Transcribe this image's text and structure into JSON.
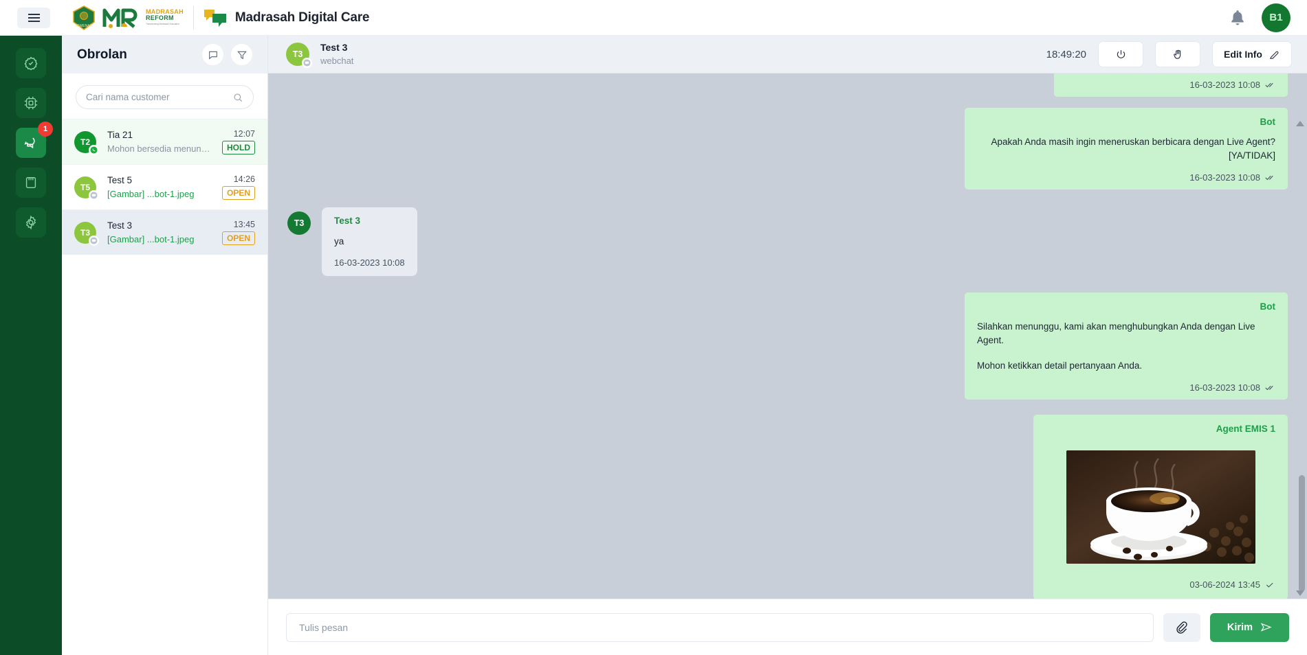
{
  "topbar": {
    "menu_icon": "hamburger-icon",
    "app_title": "Madrasah Digital Care",
    "logo_primary_line1": "MADRASAH",
    "logo_primary_line2": "REFORM",
    "logo_primary_line3": "Transforming Madrasah Education",
    "logo_mark": "MR",
    "bell_icon": "bell-icon",
    "avatar_initials": "B1"
  },
  "rail": {
    "items": [
      {
        "icon": "badge-check-icon",
        "active": false,
        "badge": ""
      },
      {
        "icon": "chip-icon",
        "active": false,
        "badge": ""
      },
      {
        "icon": "chat-bubbles-icon",
        "active": true,
        "badge": "1"
      },
      {
        "icon": "memory-card-icon",
        "active": false,
        "badge": ""
      },
      {
        "icon": "gear-icon",
        "active": false,
        "badge": ""
      }
    ]
  },
  "chat_list": {
    "title": "Obrolan",
    "header_icons": [
      "comment-icon",
      "filter-icon"
    ],
    "search": {
      "placeholder": "Cari nama customer",
      "value": "",
      "icon": "search-icon"
    },
    "items": [
      {
        "initials": "T2",
        "avatar_color": "#12962f",
        "channel_icon": "whatsapp-icon",
        "name": "Tia 21",
        "preview": "Mohon bersedia menunggu,...",
        "preview_green": false,
        "time": "12:07",
        "status": "HOLD",
        "status_kind": "hold",
        "state": "unread"
      },
      {
        "initials": "T5",
        "avatar_color": "#8cc63e",
        "channel_icon": "webchat-icon",
        "name": "Test 5",
        "preview": "[Gambar] ...bot-1.jpeg",
        "preview_green": true,
        "time": "14:26",
        "status": "OPEN",
        "status_kind": "open",
        "state": "normal"
      },
      {
        "initials": "T3",
        "avatar_color": "#8cc63e",
        "channel_icon": "webchat-icon",
        "name": "Test 3",
        "preview": "[Gambar] ...bot-1.jpeg",
        "preview_green": true,
        "time": "13:45",
        "status": "OPEN",
        "status_kind": "open",
        "state": "selected"
      }
    ]
  },
  "conversation": {
    "header": {
      "avatar_initials": "T3",
      "name": "Test 3",
      "channel": "webchat",
      "timer": "18:49:20",
      "power_icon": "power-icon",
      "hand_icon": "hand-icon",
      "edit_label": "Edit Info",
      "edit_icon": "edit-pencil-icon"
    },
    "messages": [
      {
        "id": "m0",
        "dir": "out",
        "sender": "",
        "texts": [],
        "time": "16-03-2023 10:08",
        "status_icon": "double-check-icon",
        "clipped_top": true
      },
      {
        "id": "m1",
        "dir": "out",
        "sender": "Bot",
        "texts": [
          "Apakah Anda masih ingin meneruskan berbicara dengan Live Agent?[YA/TIDAK]"
        ],
        "time": "16-03-2023 10:08",
        "status_icon": "double-check-icon"
      },
      {
        "id": "m2",
        "dir": "in",
        "avatar_initials": "T3",
        "sender": "Test 3",
        "texts": [
          "ya"
        ],
        "time": "16-03-2023 10:08",
        "status_icon": ""
      },
      {
        "id": "m3",
        "dir": "out",
        "sender": "Bot",
        "texts": [
          "Silahkan menunggu, kami akan menghubungkan Anda dengan Live Agent.",
          "Mohon ketikkan detail pertanyaan Anda."
        ],
        "time": "16-03-2023 10:08",
        "status_icon": "double-check-icon"
      },
      {
        "id": "m4",
        "dir": "out",
        "sender": "Agent EMIS 1",
        "texts": [],
        "image": "coffee-cup-photo",
        "time": "03-06-2024 13:45",
        "status_icon": "single-check-icon"
      }
    ]
  },
  "composer": {
    "placeholder": "Tulis pesan",
    "value": "",
    "attach_icon": "paperclip-icon",
    "send_label": "Kirim",
    "send_icon": "send-icon"
  },
  "colors": {
    "brand_green": "#0c4c26",
    "accent_green": "#2fa35b",
    "bubble_out": "#c9f3cf",
    "bubble_in": "#e8ecf2",
    "conv_bg": "#c9cfd8",
    "badge_red": "#ef3b34",
    "status_open": "#e2a11c",
    "status_hold": "#1f8a3f"
  }
}
